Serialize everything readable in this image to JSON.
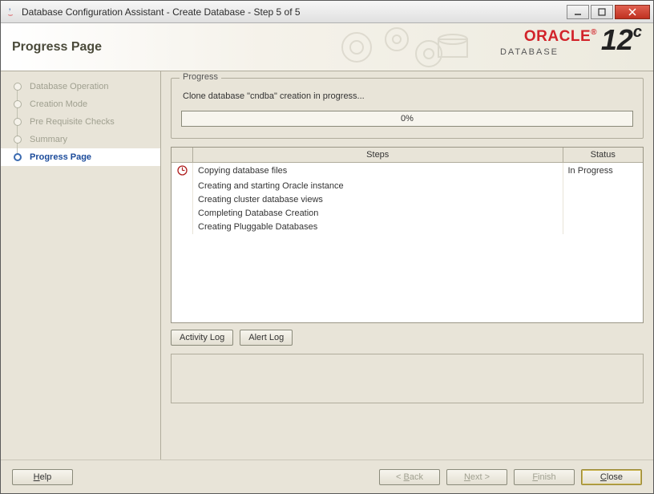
{
  "window": {
    "title": "Database Configuration Assistant - Create Database - Step 5 of 5"
  },
  "banner": {
    "title": "Progress Page",
    "brand": "ORACLE",
    "brand_reg": "®",
    "product": "DATABASE",
    "version_num": "12",
    "version_suffix": "c"
  },
  "sidebar": {
    "steps": [
      {
        "label": "Database Operation"
      },
      {
        "label": "Creation Mode"
      },
      {
        "label": "Pre Requisite Checks"
      },
      {
        "label": "Summary"
      },
      {
        "label": "Progress Page"
      }
    ],
    "current_index": 4
  },
  "progress": {
    "legend": "Progress",
    "message": "Clone database \"cndba\" creation in progress...",
    "percent_text": "0%"
  },
  "steps_table": {
    "columns": {
      "steps": "Steps",
      "status": "Status"
    },
    "rows": [
      {
        "label": "Copying database files",
        "status": "In Progress",
        "in_progress": true
      },
      {
        "label": "Creating and starting Oracle instance",
        "status": "",
        "in_progress": false
      },
      {
        "label": "Creating cluster database views",
        "status": "",
        "in_progress": false
      },
      {
        "label": "Completing Database Creation",
        "status": "",
        "in_progress": false
      },
      {
        "label": "Creating Pluggable Databases",
        "status": "",
        "in_progress": false
      }
    ]
  },
  "log_buttons": {
    "activity": "Activity Log",
    "alert": "Alert Log"
  },
  "footer": {
    "help": "Help",
    "back": "< Back",
    "next": "Next >",
    "finish": "Finish",
    "close": "Close"
  }
}
